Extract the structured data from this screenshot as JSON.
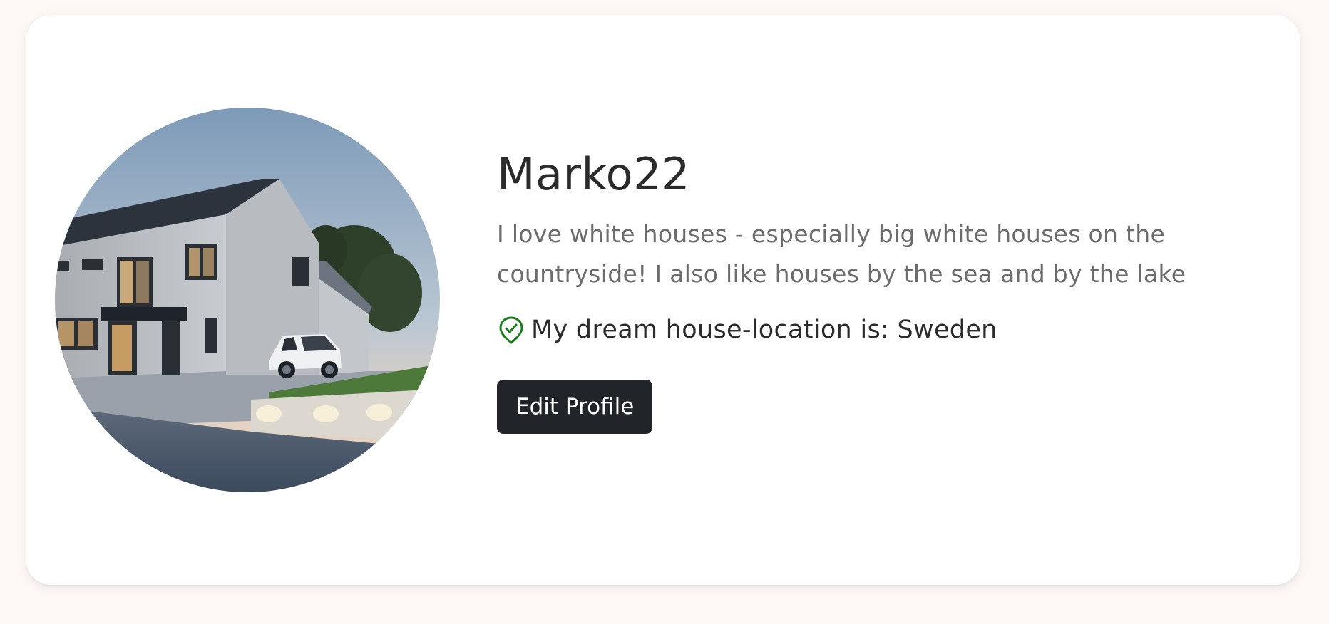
{
  "profile": {
    "username": "Marko22",
    "bio": "I love white houses - especially big white houses on the countryside! I also like houses by the sea and by the lake",
    "location_text": "My dream house-location is: Sweden",
    "location_icon": "location-check-icon",
    "location_icon_color": "#1a7f1a",
    "edit_button_label": "Edit Profile",
    "avatar_description_icon": "house-photo"
  },
  "colors": {
    "button_bg": "#212529",
    "card_bg": "#ffffff",
    "page_bg": "#fdf8f6"
  }
}
